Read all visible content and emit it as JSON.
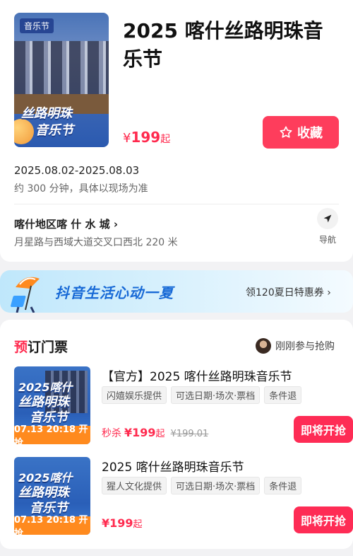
{
  "product": {
    "poster_tag": "音乐节",
    "poster_line1": "2025 喀什",
    "poster_line2": "丝路明珠",
    "poster_line3": "音乐节",
    "title": "2025 喀什丝路明珠音乐节",
    "price_currency": "¥",
    "price_value": "199",
    "price_suffix": "起",
    "favorite_label": "收藏",
    "date_range": "2025.08.02-2025.08.03",
    "duration": "约 300 分钟，具体以现场为准",
    "venue": "喀什地区喀 什 水 城",
    "address": "月星路与西域大道交叉口西北 220 米",
    "navigate_label": "导航"
  },
  "banner": {
    "title": "抖音生活心动一夏",
    "link": "领120夏日特惠券"
  },
  "tickets": {
    "section_title_first": "预",
    "section_title_rest": "订门票",
    "social_text": "刚刚参与抢购",
    "items": [
      {
        "img_line1": "2025喀什",
        "img_line2": "丝路明珠",
        "img_line3": "音乐节",
        "sale_time": "07.13 20:18 开抢",
        "name": "【官方】2025 喀什丝路明珠音乐节",
        "tags": [
          "闪嬉娱乐提供",
          "可选日期·场次·票档",
          "条件退"
        ],
        "price_label": "秒杀",
        "price_currency": "¥",
        "price_value": "199",
        "price_suffix": "起",
        "original_price": "¥199.01",
        "button_label": "即将开抢"
      },
      {
        "img_line1": "2025喀什",
        "img_line2": "丝路明珠",
        "img_line3": "音乐节",
        "sale_time": "07.13 20:18 开抢",
        "name": "2025 喀什丝路明珠音乐节",
        "tags": [
          "猩人文化提供",
          "可选日期·场次·票档",
          "条件退"
        ],
        "price_label": "",
        "price_currency": "¥",
        "price_value": "199",
        "price_suffix": "起",
        "original_price": "",
        "button_label": "即将开抢"
      }
    ]
  },
  "colors": {
    "accent": "#fe2c55",
    "price": "#ff2a4e",
    "countdown": "#ff8a1e",
    "banner_text": "#1769d6"
  }
}
